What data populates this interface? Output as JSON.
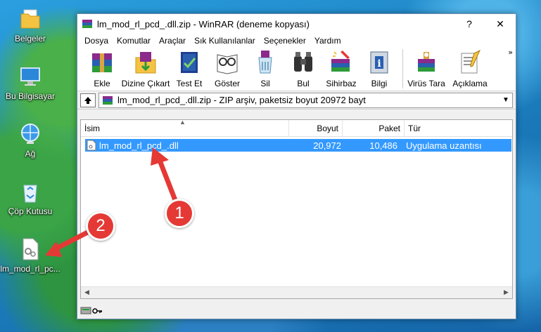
{
  "desktop": {
    "icons": [
      {
        "label": "Belgeler",
        "icon": "folder-icon"
      },
      {
        "label": "Bu Bilgisayar",
        "icon": "computer-icon"
      },
      {
        "label": "Ağ",
        "icon": "network-icon"
      },
      {
        "label": "Çöp Kutusu",
        "icon": "recycle-bin-icon"
      },
      {
        "label": "lm_mod_rl_pc...",
        "icon": "dll-file-icon"
      }
    ]
  },
  "window": {
    "title": "lm_mod_rl_pcd_.dll.zip - WinRAR (deneme kopyası)",
    "help_label": "?",
    "close_label": "✕",
    "menu": [
      "Dosya",
      "Komutlar",
      "Araçlar",
      "Sık Kullanılanlar",
      "Seçenekler",
      "Yardım"
    ],
    "toolbar": [
      {
        "label": "Ekle",
        "icon": "add-icon"
      },
      {
        "label": "Dizine Çıkart",
        "icon": "extract-icon"
      },
      {
        "label": "Test Et",
        "icon": "test-icon"
      },
      {
        "label": "Göster",
        "icon": "view-icon"
      },
      {
        "label": "Sil",
        "icon": "delete-icon"
      },
      {
        "label": "Bul",
        "icon": "find-icon"
      },
      {
        "label": "Sihirbaz",
        "icon": "wizard-icon"
      },
      {
        "label": "Bilgi",
        "icon": "info-icon"
      },
      {
        "label": "Virüs Tara",
        "icon": "virus-scan-icon"
      },
      {
        "label": "Açıklama",
        "icon": "comment-icon"
      }
    ],
    "more_label": "»",
    "path": "lm_mod_rl_pcd_.dll.zip - ZIP arşiv, paketsiz boyut 20972 bayt",
    "columns": {
      "name": "İsim",
      "size": "Boyut",
      "packed": "Paket",
      "type": "Tür"
    },
    "files": [
      {
        "name": "lm_mod_rl_pcd_.dll",
        "size": "20,972",
        "packed": "10,486",
        "type": "Uygulama uzantısı"
      }
    ]
  },
  "annotations": {
    "badge1": "1",
    "badge2": "2",
    "color": "#e53935"
  }
}
